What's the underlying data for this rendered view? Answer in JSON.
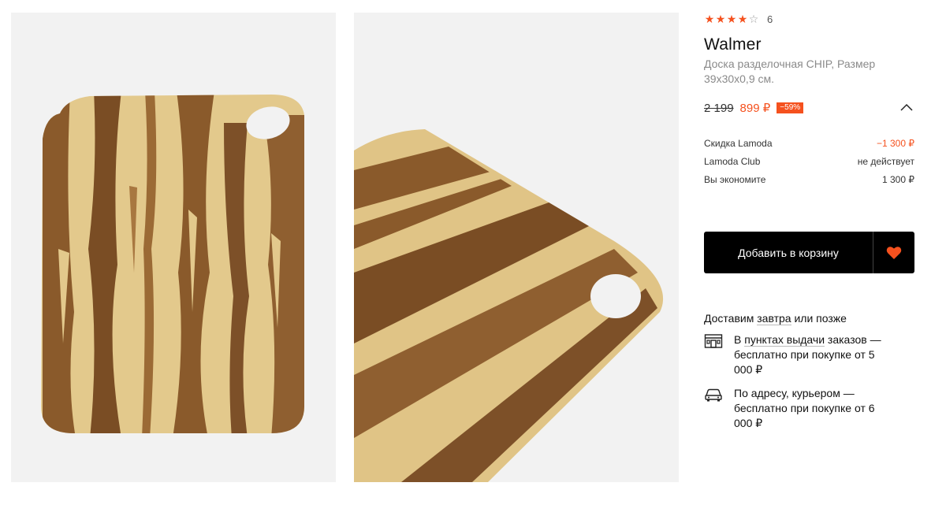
{
  "product": {
    "rating": {
      "stars": 4,
      "max": 5,
      "count": "6"
    },
    "brand": "Walmer",
    "name": "Доска разделочная CHIP, Размер 39x30x0,9 см.",
    "old_price": "2 199",
    "new_price": "899 ₽",
    "discount": "−59%"
  },
  "breakdown": [
    {
      "label": "Скидка Lamoda",
      "value": "−1 300 ₽",
      "accent": true
    },
    {
      "label": "Lamoda Club",
      "value": "не действует",
      "accent": false
    },
    {
      "label": "Вы экономите",
      "value": "1 300 ₽",
      "accent": false
    }
  ],
  "actions": {
    "add_to_cart": "Добавить в корзину"
  },
  "delivery": {
    "title_before": "Доставим ",
    "title_link": "завтра",
    "title_after": " или позже",
    "pickup": {
      "before": "В ",
      "link": "пунктах выдачи",
      "after": " заказов — бесплатно при покупке от 5 000 ₽"
    },
    "courier": {
      "text": "По адресу, курьером — бесплатно при покупке от 6 000 ₽"
    }
  },
  "colors": {
    "accent": "#f5511e",
    "button": "#000000",
    "wood_light": "#e3c98c",
    "wood_dark": "#8a5a2b",
    "photo_bg": "#f2f2f2"
  },
  "icons": [
    "star-icon",
    "chevron-up-icon",
    "heart-icon",
    "pickup-point-icon",
    "courier-car-icon"
  ]
}
